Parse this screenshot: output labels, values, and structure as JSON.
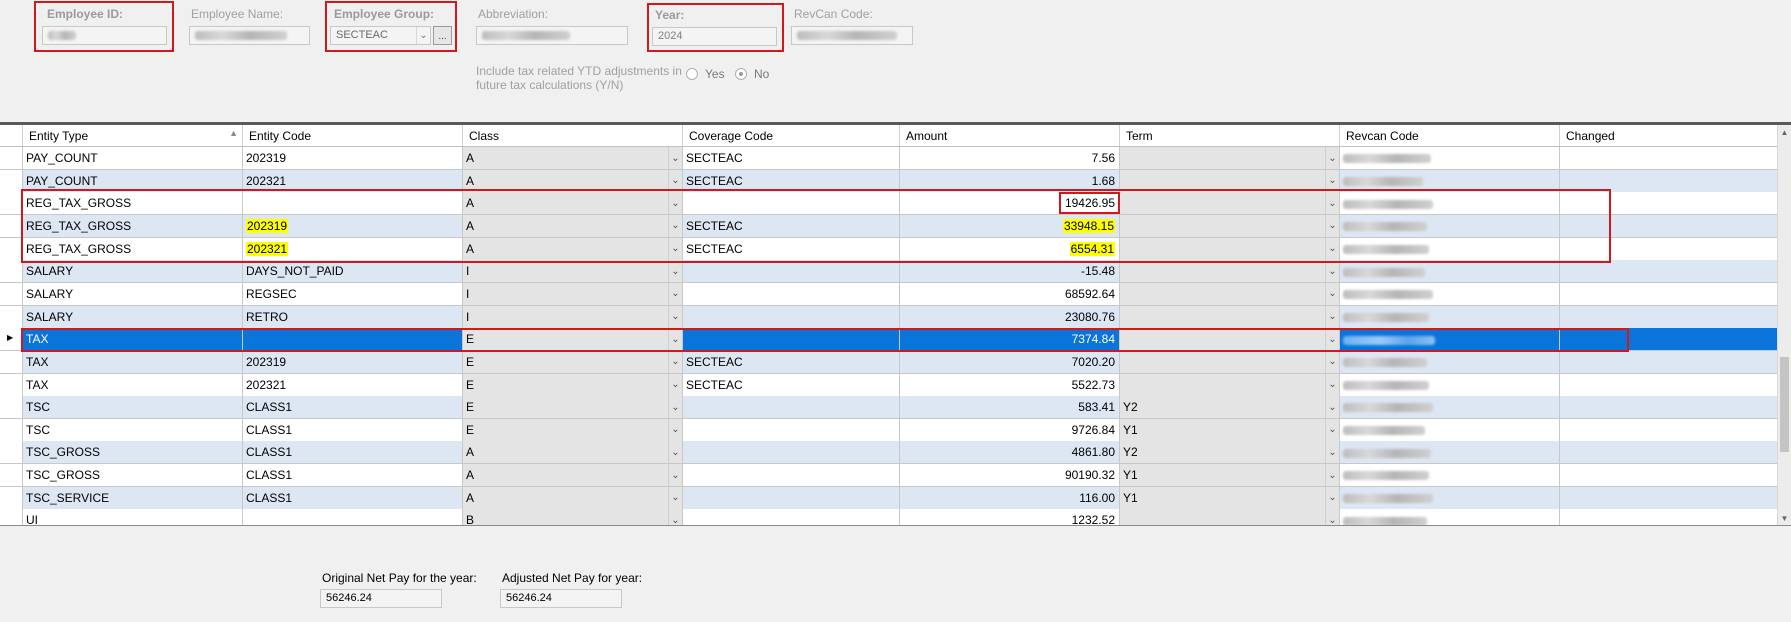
{
  "header": {
    "employee_id": {
      "label": "Employee ID:",
      "value": ""
    },
    "employee_name": {
      "label": "Employee Name:",
      "value": ""
    },
    "employee_group": {
      "label": "Employee Group:",
      "value": "SECTEAC",
      "lookup_button": "..."
    },
    "abbreviation": {
      "label": "Abbreviation:",
      "value": ""
    },
    "year": {
      "label": "Year:",
      "value": "2024"
    },
    "revcan_code": {
      "label": "RevCan Code:",
      "value": ""
    },
    "ytd_question": {
      "line1": "Include tax related YTD adjustments in",
      "line2": "future tax calculations (Y/N)"
    },
    "radio_yes": "Yes",
    "radio_no": "No",
    "selected_option": "No"
  },
  "grid": {
    "columns": [
      "Entity Type",
      "Entity Code",
      "Class",
      "Coverage Code",
      "Amount",
      "Term",
      "Revcan Code",
      "Changed"
    ],
    "rows": [
      {
        "type": "PAY_COUNT",
        "code": "202319",
        "class": "A",
        "coverage": "SECTEAC",
        "amount": "7.56",
        "term": ""
      },
      {
        "type": "PAY_COUNT",
        "code": "202321",
        "class": "A",
        "coverage": "SECTEAC",
        "amount": "1.68",
        "term": ""
      },
      {
        "type": "REG_TAX_GROSS",
        "code": "",
        "class": "A",
        "coverage": "",
        "amount": "19426.95",
        "term": ""
      },
      {
        "type": "REG_TAX_GROSS",
        "code": "202319",
        "class": "A",
        "coverage": "SECTEAC",
        "amount": "33948.15",
        "term": ""
      },
      {
        "type": "REG_TAX_GROSS",
        "code": "202321",
        "class": "A",
        "coverage": "SECTEAC",
        "amount": "6554.31",
        "term": ""
      },
      {
        "type": "SALARY",
        "code": "DAYS_NOT_PAID",
        "class": "I",
        "coverage": "",
        "amount": "-15.48",
        "term": ""
      },
      {
        "type": "SALARY",
        "code": "REGSEC",
        "class": "I",
        "coverage": "",
        "amount": "68592.64",
        "term": ""
      },
      {
        "type": "SALARY",
        "code": "RETRO",
        "class": "I",
        "coverage": "",
        "amount": "23080.76",
        "term": ""
      },
      {
        "type": "TAX",
        "code": "",
        "class": "E",
        "coverage": "",
        "amount": "7374.84",
        "term": ""
      },
      {
        "type": "TAX",
        "code": "202319",
        "class": "E",
        "coverage": "SECTEAC",
        "amount": "7020.20",
        "term": ""
      },
      {
        "type": "TAX",
        "code": "202321",
        "class": "E",
        "coverage": "SECTEAC",
        "amount": "5522.73",
        "term": ""
      },
      {
        "type": "TSC",
        "code": "CLASS1",
        "class": "E",
        "coverage": "",
        "amount": "583.41",
        "term": "Y2"
      },
      {
        "type": "TSC",
        "code": "CLASS1",
        "class": "E",
        "coverage": "",
        "amount": "9726.84",
        "term": "Y1"
      },
      {
        "type": "TSC_GROSS",
        "code": "CLASS1",
        "class": "A",
        "coverage": "",
        "amount": "4861.80",
        "term": "Y2"
      },
      {
        "type": "TSC_GROSS",
        "code": "CLASS1",
        "class": "A",
        "coverage": "",
        "amount": "90190.32",
        "term": "Y1"
      },
      {
        "type": "TSC_SERVICE",
        "code": "CLASS1",
        "class": "A",
        "coverage": "",
        "amount": "116.00",
        "term": "Y1"
      },
      {
        "type": "UI",
        "code": "",
        "class": "B",
        "coverage": "",
        "amount": "1232.52",
        "term": ""
      }
    ]
  },
  "footer": {
    "original_label": "Original Net Pay for the year:",
    "original_value": "56246.24",
    "adjusted_label": "Adjusted Net Pay for year:",
    "adjusted_value": "56246.24"
  },
  "colors": {
    "selection": "#0a74da",
    "alt_row": "#dde6f3",
    "highlight": "#ffff00",
    "annotation": "#d0191c"
  }
}
